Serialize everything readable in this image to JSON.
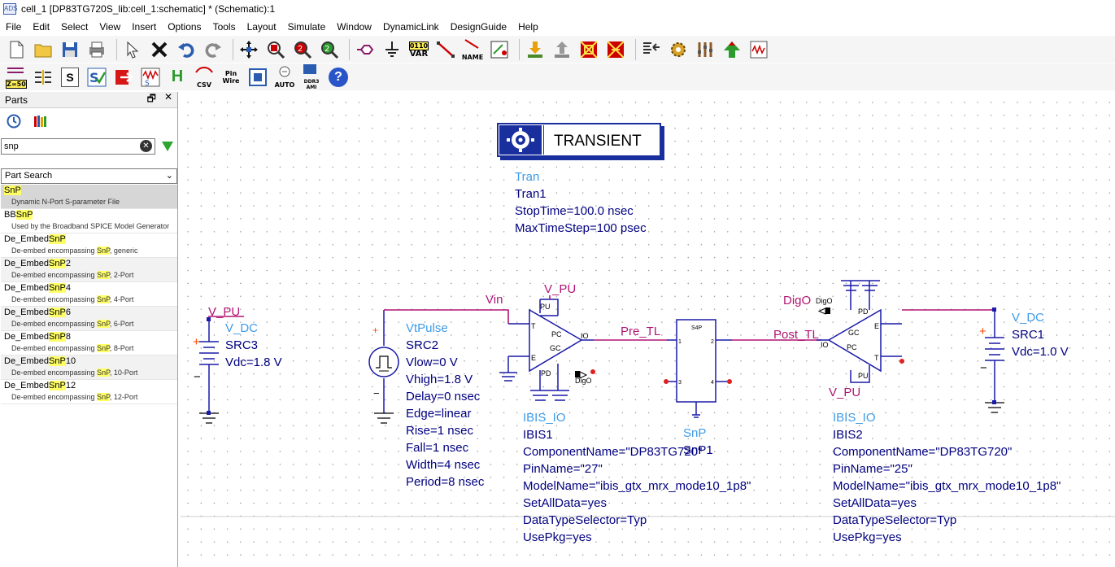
{
  "window": {
    "title": "cell_1 [DP83TG720S_lib:cell_1:schematic] * (Schematic):1"
  },
  "menu": [
    "File",
    "Edit",
    "Select",
    "View",
    "Insert",
    "Options",
    "Tools",
    "Layout",
    "Simulate",
    "Window",
    "DynamicLink",
    "DesignGuide",
    "Help"
  ],
  "toolbar1": {
    "var_top": "0110",
    "var_label": "VAR",
    "name_label": "NAME"
  },
  "toolbar2": {
    "z50_label": "Z=50",
    "s_label": "S",
    "h_label": "H",
    "csv_label": "CSV",
    "pin_label": "Pin",
    "wire_label": "Wire",
    "auto_label": "AUTO",
    "ddr_label": "DDR3 AMI"
  },
  "parts_panel": {
    "title": "Parts",
    "search_value": "snp",
    "search_mode": "Part Search",
    "items": [
      {
        "pre": "",
        "hl": "SnP",
        "post": "",
        "dpre": "Dynamic N-Port S-parameter File",
        "dhl": "",
        "dpost": ""
      },
      {
        "pre": "BB",
        "hl": "SnP",
        "post": "",
        "dpre": "Used by the Broadband SPICE Model Generator",
        "dhl": "",
        "dpost": ""
      },
      {
        "pre": "De_Embed",
        "hl": "SnP",
        "post": "",
        "dpre": "De-embed encompassing ",
        "dhl": "SnP",
        "dpost": ", generic"
      },
      {
        "pre": "De_Embed",
        "hl": "SnP",
        "post": "2",
        "dpre": "De-embed encompassing ",
        "dhl": "SnP",
        "dpost": ", 2-Port"
      },
      {
        "pre": "De_Embed",
        "hl": "SnP",
        "post": "4",
        "dpre": "De-embed encompassing ",
        "dhl": "SnP",
        "dpost": ", 4-Port"
      },
      {
        "pre": "De_Embed",
        "hl": "SnP",
        "post": "6",
        "dpre": "De-embed encompassing ",
        "dhl": "SnP",
        "dpost": ", 6-Port"
      },
      {
        "pre": "De_Embed",
        "hl": "SnP",
        "post": "8",
        "dpre": "De-embed encompassing ",
        "dhl": "SnP",
        "dpost": ", 8-Port"
      },
      {
        "pre": "De_Embed",
        "hl": "SnP",
        "post": "10",
        "dpre": "De-embed encompassing ",
        "dhl": "SnP",
        "dpost": ", 10-Port"
      },
      {
        "pre": "De_Embed",
        "hl": "SnP",
        "post": "12",
        "dpre": "De-embed encompassing ",
        "dhl": "SnP",
        "dpost": ", 12-Port"
      }
    ]
  },
  "schematic": {
    "transient_title": "TRANSIENT",
    "tran": {
      "type": "Tran",
      "name": "Tran1",
      "stop": "StopTime=100.0 nsec",
      "step": "MaxTimeStep=100 psec"
    },
    "src3": {
      "net": "V_PU",
      "type": "V_DC",
      "name": "SRC3",
      "vdc": "Vdc=1.8 V"
    },
    "src1": {
      "type": "V_DC",
      "name": "SRC1",
      "vdc": "Vdc=1.0 V"
    },
    "src2": {
      "type": "VtPulse",
      "name": "SRC2",
      "params": [
        "Vlow=0 V",
        "Vhigh=1.8 V",
        "Delay=0 nsec",
        "Edge=linear",
        "Rise=1 nsec",
        "Fall=1 nsec",
        "Width=4 nsec",
        "Period=8 nsec"
      ]
    },
    "nets": {
      "vin": "Vin",
      "vpu1": "V_PU",
      "vpu2": "V_PU",
      "pre_tl": "Pre_TL",
      "post_tl": "Post_TL",
      "digo": "DigO"
    },
    "ibis1": {
      "type": "IBIS_IO",
      "name": "IBIS1",
      "params": [
        "ComponentName=\"DP83TG720\"",
        "PinName=\"27\"",
        "ModelName=\"ibis_gtx_mrx_mode10_1p8\"",
        "SetAllData=yes",
        "DataTypeSelector=Typ",
        "UsePkg=yes"
      ]
    },
    "ibis2": {
      "type": "IBIS_IO",
      "name": "IBIS2",
      "params": [
        "ComponentName=\"DP83TG720\"",
        "PinName=\"25\"",
        "ModelName=\"ibis_gtx_mrx_mode10_1p8\"",
        "SetAllData=yes",
        "DataTypeSelector=Typ",
        "UsePkg=yes"
      ]
    },
    "snp": {
      "type": "SnP",
      "name": "SnP1",
      "header": "S4P",
      "ports": [
        "1",
        "2",
        "3",
        "4"
      ]
    },
    "pins": {
      "t": "T",
      "e": "E",
      "pc": "PC",
      "gc": "GC",
      "io": "IO",
      "pu": "PU",
      "pd": "PD",
      "digo_small": "DigO"
    }
  },
  "colors": {
    "component_text": "#3d9be9",
    "net_wire": "#b01574",
    "component_body": "#1a1aa8",
    "param_text": "#000000"
  }
}
